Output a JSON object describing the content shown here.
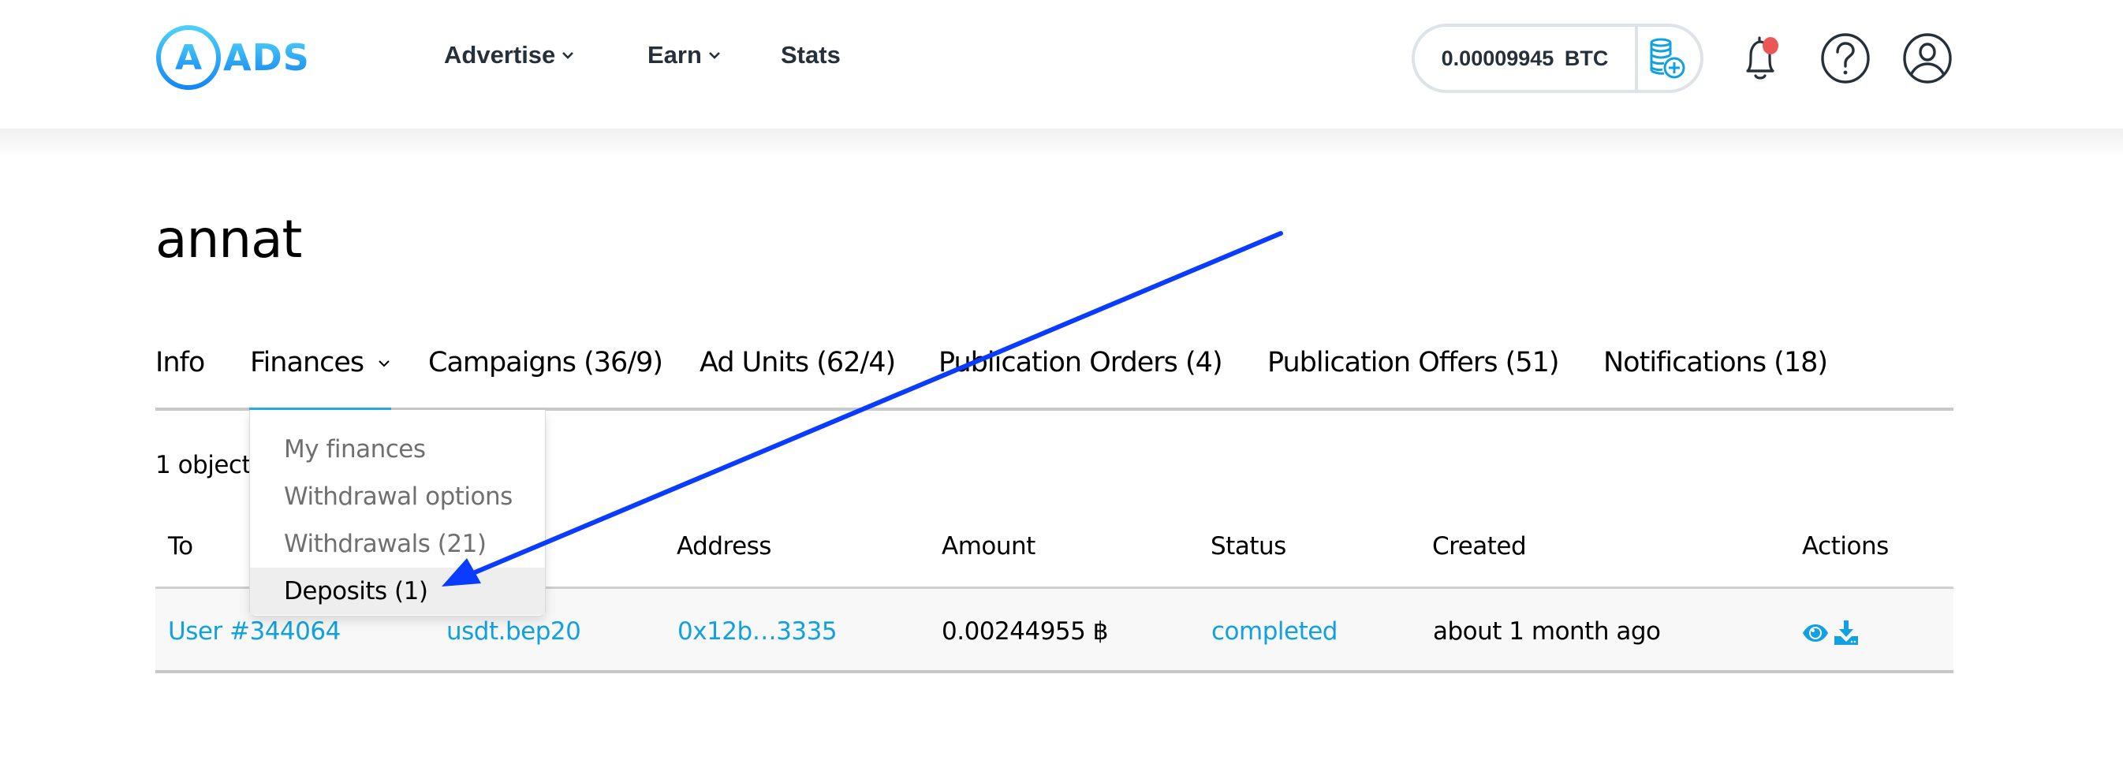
{
  "header": {
    "logo_text": "ADS",
    "logo_mark": "A",
    "nav": [
      {
        "label": "Advertise",
        "has_dropdown": true
      },
      {
        "label": "Earn",
        "has_dropdown": true
      },
      {
        "label": "Stats",
        "has_dropdown": false
      }
    ],
    "balance": {
      "amount": "0.00009945",
      "currency": "BTC",
      "add_funds_icon": "coins-plus-icon"
    },
    "icons": {
      "notifications": "bell-icon",
      "notification_badge_color": "#eb5757",
      "help": "help-circle-icon",
      "profile": "user-circle-icon"
    }
  },
  "page": {
    "title": "annat",
    "tabs": [
      {
        "label": "Info",
        "active": false
      },
      {
        "label": "Finances",
        "active": true,
        "has_dropdown": true
      },
      {
        "label": "Campaigns (36/9)",
        "active": false
      },
      {
        "label": "Ad Units (62/4)",
        "active": false
      },
      {
        "label": "Publication Orders (4)",
        "active": false
      },
      {
        "label": "Publication Offers (51)",
        "active": false
      },
      {
        "label": "Notifications (18)",
        "active": false
      }
    ],
    "finances_menu": [
      {
        "label": "My finances",
        "active": false
      },
      {
        "label": "Withdrawal options",
        "active": false
      },
      {
        "label": "Withdrawals (21)",
        "active": false
      },
      {
        "label": "Deposits (1)",
        "active": true
      }
    ],
    "object_count": "1 object",
    "table": {
      "columns": [
        "To",
        "",
        "Address",
        "Amount",
        "Status",
        "Created",
        "Actions"
      ],
      "rows": [
        {
          "to": "User #344064",
          "method": "usdt.bep20",
          "address": "0x12b…3335",
          "amount": "0.00244955 ฿",
          "status": "completed",
          "created": "about 1 month ago",
          "actions": [
            "eye-icon",
            "download-icon"
          ]
        }
      ]
    }
  },
  "colors": {
    "brand": "#29abe2",
    "link": "#11a0e0",
    "annotation_arrow": "#0a3cff",
    "text_dark": "#25303a"
  }
}
